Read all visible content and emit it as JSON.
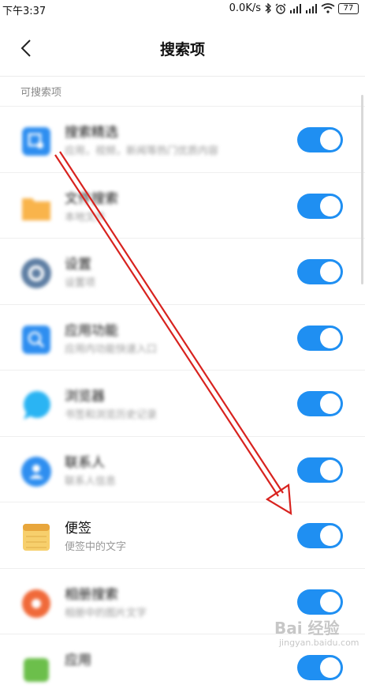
{
  "status_bar": {
    "time": "下午3:37",
    "network_speed": "0.0K/s",
    "battery": "77"
  },
  "header": {
    "back_icon": "chevron-left-icon",
    "title": "搜索项"
  },
  "section_label": "可搜索项",
  "items": [
    {
      "title": "搜索精选",
      "subtitle": "应用，视频，新闻等热门优质内容",
      "icon": "image-search-icon",
      "icon_color": "#2e8ef0",
      "enabled": true,
      "blurred": true
    },
    {
      "title": "文件搜索",
      "subtitle": "本地文件",
      "icon": "folder-icon",
      "icon_color": "#f9b44b",
      "enabled": true,
      "blurred": true
    },
    {
      "title": "设置",
      "subtitle": "设置项",
      "icon": "gear-icon",
      "icon_color": "#5e7ea3",
      "enabled": true,
      "blurred": true
    },
    {
      "title": "应用功能",
      "subtitle": "应用内功能快速入口",
      "icon": "app-search-icon",
      "icon_color": "#2e8ef0",
      "enabled": true,
      "blurred": true
    },
    {
      "title": "浏览器",
      "subtitle": "书签和浏览历史记录",
      "icon": "chat-bubble-icon",
      "icon_color": "#2ab4f3",
      "enabled": true,
      "blurred": true
    },
    {
      "title": "联系人",
      "subtitle": "联系人信息",
      "icon": "contact-icon",
      "icon_color": "#2e8ef0",
      "enabled": true,
      "blurred": true
    },
    {
      "title": "便签",
      "subtitle": "便签中的文字",
      "icon": "notepad-icon",
      "icon_color": "#f5c35c",
      "enabled": true,
      "blurred": false
    },
    {
      "title": "相册搜索",
      "subtitle": "相册中的图片文字",
      "icon": "flower-icon",
      "icon_color": "#f06a3a",
      "enabled": true,
      "blurred": true
    },
    {
      "title": "应用",
      "subtitle": "",
      "icon": "android-icon",
      "icon_color": "#6cbf4b",
      "enabled": true,
      "blurred": true
    }
  ],
  "colors": {
    "toggle_on": "#1f8ff2",
    "annotation_arrow": "#d8231f"
  },
  "watermark": {
    "main": "Bai 经验",
    "sub": "jingyan.baidu.com"
  }
}
